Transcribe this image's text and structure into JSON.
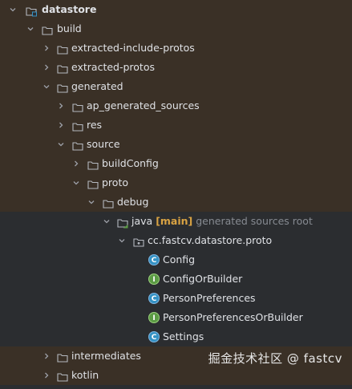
{
  "tree": {
    "items": [
      {
        "label": "datastore",
        "bold": true,
        "icon": "module-folder-icon",
        "chevron": "down",
        "brown": true
      },
      {
        "label": "build",
        "icon": "folder-icon",
        "chevron": "down",
        "brown": true
      },
      {
        "label": "extracted-include-protos",
        "icon": "folder-icon",
        "chevron": "right",
        "brown": true
      },
      {
        "label": "extracted-protos",
        "icon": "folder-icon",
        "chevron": "right",
        "brown": true
      },
      {
        "label": "generated",
        "icon": "folder-icon",
        "chevron": "down",
        "brown": true
      },
      {
        "label": "ap_generated_sources",
        "icon": "folder-icon",
        "chevron": "right",
        "brown": true
      },
      {
        "label": "res",
        "icon": "folder-icon",
        "chevron": "right",
        "brown": true
      },
      {
        "label": "source",
        "icon": "folder-icon",
        "chevron": "down",
        "brown": true
      },
      {
        "label": "buildConfig",
        "icon": "folder-icon",
        "chevron": "right",
        "brown": true
      },
      {
        "label": "proto",
        "icon": "folder-icon",
        "chevron": "down",
        "brown": true
      },
      {
        "label": "debug",
        "icon": "folder-icon",
        "chevron": "down",
        "brown": true
      },
      {
        "label": "java",
        "tag": "[main]",
        "hint": "generated sources root",
        "icon": "source-root-folder-icon",
        "chevron": "down",
        "brown": false
      },
      {
        "label": "cc.fastcv.datastore.proto",
        "icon": "package-icon",
        "chevron": "down",
        "brown": false
      },
      {
        "label": "Config",
        "icon": "class-icon",
        "brown": false
      },
      {
        "label": "ConfigOrBuilder",
        "icon": "interface-icon",
        "brown": false
      },
      {
        "label": "PersonPreferences",
        "icon": "class-icon",
        "brown": false
      },
      {
        "label": "PersonPreferencesOrBuilder",
        "icon": "interface-icon",
        "brown": false
      },
      {
        "label": "Settings",
        "icon": "class-icon",
        "brown": false
      },
      {
        "label": "intermediates",
        "icon": "folder-icon",
        "chevron": "right",
        "brown": true
      },
      {
        "label": "kotlin",
        "icon": "folder-icon",
        "chevron": "right",
        "brown": true
      }
    ]
  },
  "badges": {
    "class_letter": "C",
    "interface_letter": "I"
  },
  "watermark": "掘金技术社区 @ fastcv",
  "colors": {
    "background": "#2b2d30",
    "excluded_row": "#3a3026",
    "class_icon": "#3592c4",
    "interface_icon": "#5b9b44",
    "tag": "#d9a343"
  }
}
